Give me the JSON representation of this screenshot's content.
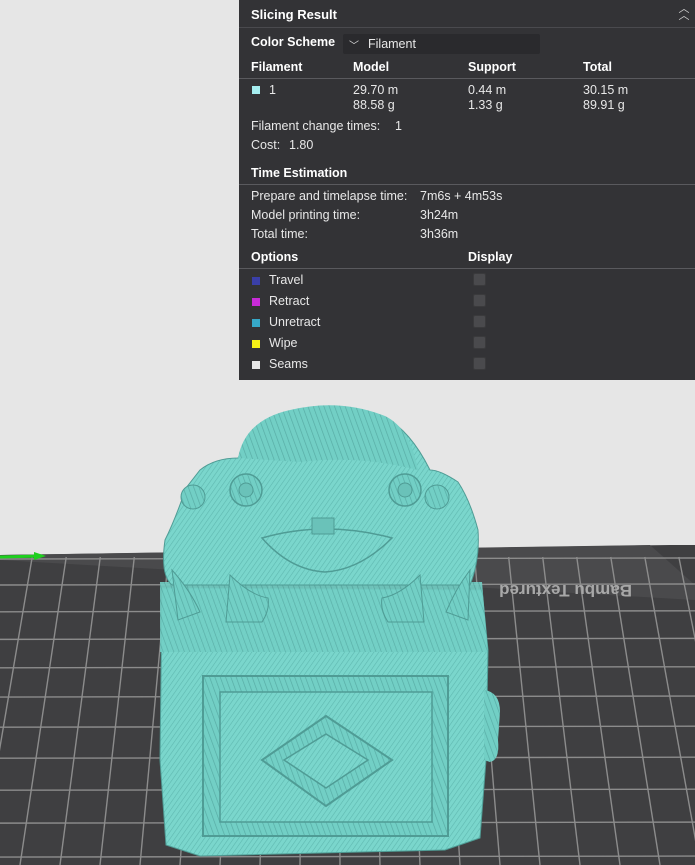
{
  "panel": {
    "title": "Slicing Result",
    "color_scheme_label": "Color Scheme",
    "color_scheme_value": "Filament",
    "filament_table": {
      "headers": [
        "Filament",
        "Model",
        "Support",
        "Total"
      ],
      "rows": [
        {
          "filament": "1",
          "swatch_color": "#a6eef0",
          "model_length": "29.70 m",
          "model_weight": "88.58 g",
          "support_length": "0.44 m",
          "support_weight": "1.33 g",
          "total_length": "30.15 m",
          "total_weight": "89.91 g"
        }
      ]
    },
    "filament_change_label": "Filament change times:",
    "filament_change_value": "1",
    "cost_label": "Cost:",
    "cost_value": "1.80",
    "time_estimation": {
      "title": "Time Estimation",
      "prepare_label": "Prepare and timelapse time:",
      "prepare_value": "7m6s + 4m53s",
      "model_label": "Model printing time:",
      "model_value": "3h24m",
      "total_label": "Total time:",
      "total_value": "3h36m"
    },
    "options": {
      "header_options": "Options",
      "header_display": "Display",
      "items": [
        {
          "label": "Travel",
          "color": "#3a3fa8",
          "checked": false
        },
        {
          "label": "Retract",
          "color": "#c82bd8",
          "checked": false
        },
        {
          "label": "Unretract",
          "color": "#36a8c8",
          "checked": false
        },
        {
          "label": "Wipe",
          "color": "#f5f016",
          "checked": false
        },
        {
          "label": "Seams",
          "color": "#e8e8e8",
          "checked": false
        }
      ]
    }
  },
  "plate": {
    "bed_text": "Bambu Textured",
    "model_color": "#7ad6cc"
  }
}
